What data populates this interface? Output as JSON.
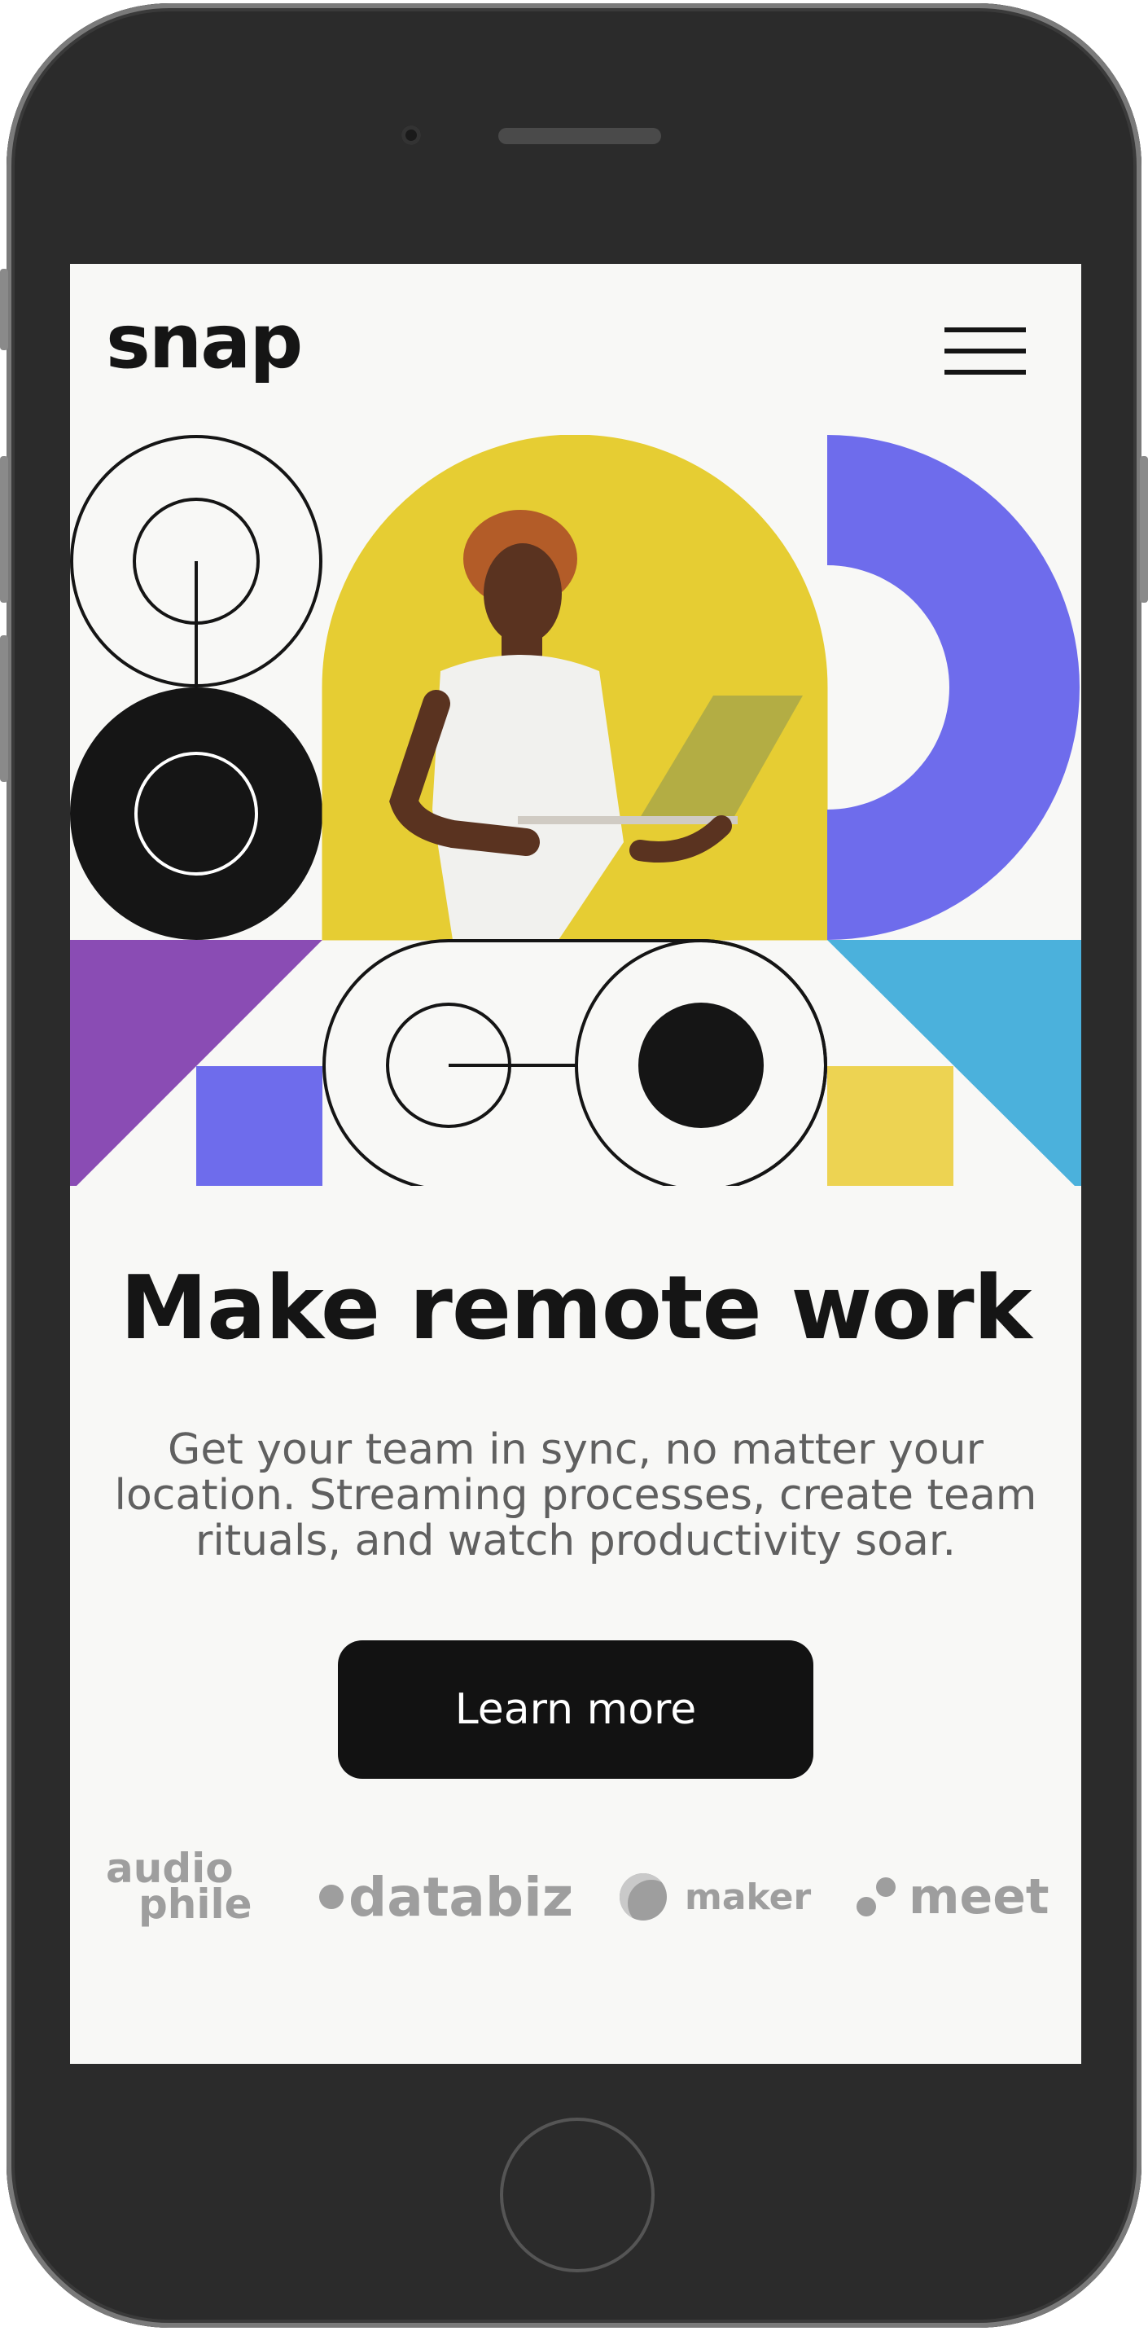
{
  "device": {
    "type": "iphone-mockup"
  },
  "header": {
    "logo": "snap",
    "menu_icon": "hamburger-icon"
  },
  "hero": {
    "photo_description_icon": "person-with-laptop-illustration"
  },
  "main": {
    "headline": "Make remote work",
    "description": "Get your team in sync, no matter your location. Streaming processes, create team rituals, and watch productivity soar.",
    "cta_label": "Learn more"
  },
  "clients": {
    "audiophile_top": "audio",
    "audiophile_bottom": "phile",
    "databiz": "databiz",
    "maker": "maker",
    "meet": "meet"
  },
  "colors": {
    "background": "#f8f8f6",
    "text_dark": "#151515",
    "text_gray": "#606060",
    "logo_gray": "#9e9e9e",
    "yellow": "#e8cf35",
    "purple": "#8a4cb4",
    "periwinkle": "#6e6cec",
    "sky_blue": "#4bb1dc",
    "square_yellow": "#edd352"
  }
}
